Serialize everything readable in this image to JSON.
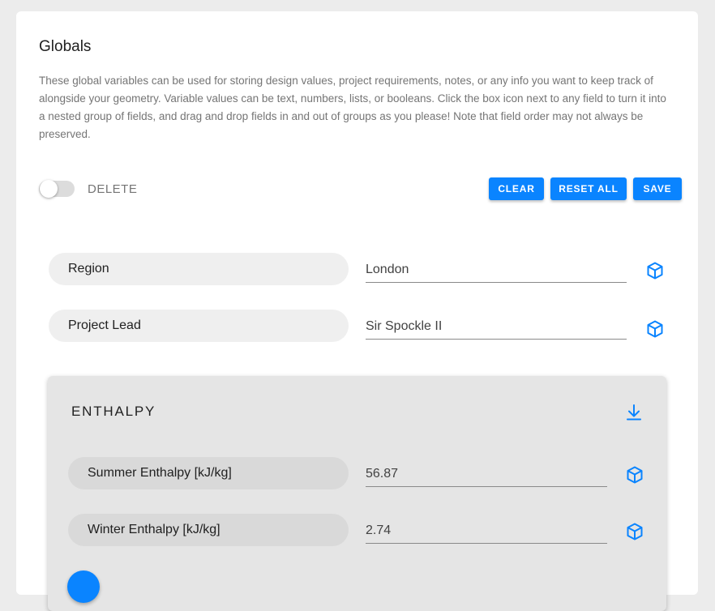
{
  "page": {
    "title": "Globals",
    "description": "These global variables can be used for storing design values, project requirements, notes, or any info you want to keep track of alongside your geometry. Variable values can be text, numbers, lists, or booleans. Click the box icon next to any field to turn it into a nested group of fields, and drag and drop fields in and out of groups as you please! Note that field order may not always be preserved."
  },
  "toolbar": {
    "delete_toggle_label": "DELETE",
    "delete_toggle_on": false,
    "clear_label": "CLEAR",
    "reset_label": "RESET ALL",
    "save_label": "SAVE"
  },
  "fields": [
    {
      "key": "Region",
      "value": "London",
      "icon": "cube-icon"
    },
    {
      "key": "Project Lead",
      "value": "Sir Spockle II",
      "icon": "cube-icon"
    }
  ],
  "group": {
    "title": "ENTHALPY",
    "action_icon": "download-icon",
    "fields": [
      {
        "key": "Summer Enthalpy [kJ/kg]",
        "value": "56.87",
        "icon": "cube-icon"
      },
      {
        "key": "Winter Enthalpy [kJ/kg]",
        "value": "2.74",
        "icon": "cube-icon"
      }
    ]
  },
  "colors": {
    "accent": "#0a84ff",
    "background": "#ececec",
    "card": "#ffffff",
    "group_background": "#e5e5e5"
  }
}
